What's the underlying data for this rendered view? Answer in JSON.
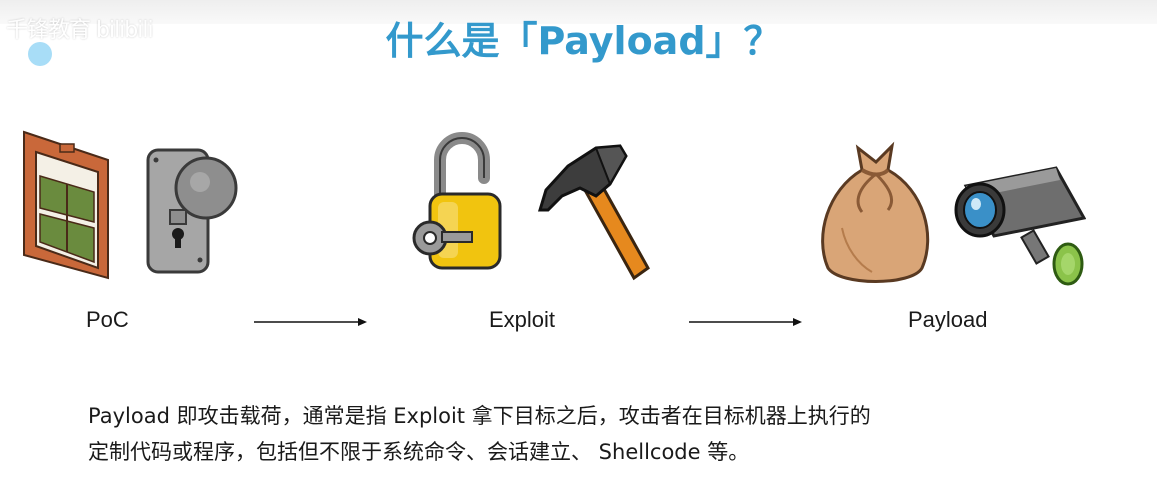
{
  "watermark": {
    "text": "千锋教育 bilibili"
  },
  "slide": {
    "title": "什么是「Payload」？",
    "stages": [
      {
        "label": "PoC",
        "icons": [
          "window-icon",
          "door-lock-icon"
        ]
      },
      {
        "label": "Exploit",
        "icons": [
          "padlock-icon",
          "hammer-icon"
        ]
      },
      {
        "label": "Payload",
        "icons": [
          "money-bag-icon",
          "security-camera-icon"
        ]
      }
    ],
    "description": [
      "Payload 即攻击载荷，通常是指 Exploit 拿下目标之后，攻击者在目标机器上执行的",
      "定制代码或程序，包括但不限于系统命令、会话建立、 Shellcode 等。"
    ]
  },
  "colors": {
    "title": "#3399cc",
    "dot": "#a8ddf7",
    "text": "#1a1a1a"
  }
}
